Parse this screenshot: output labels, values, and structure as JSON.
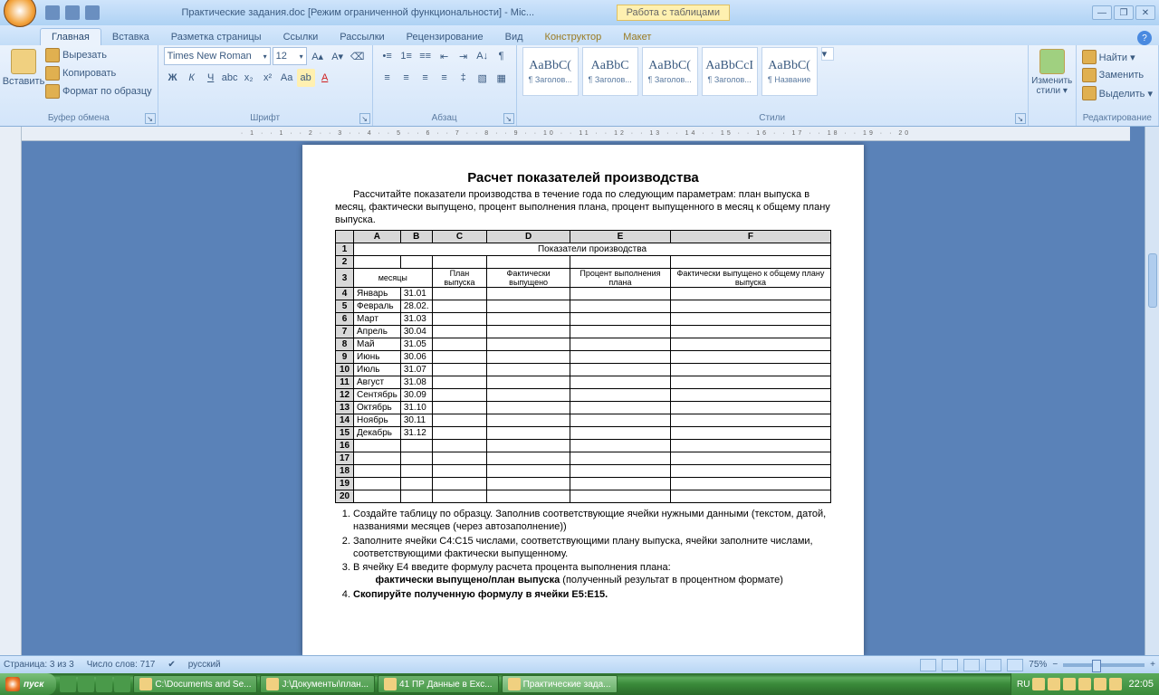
{
  "titlebar": {
    "doc_title": "Практические задания.doc [Режим ограниченной функциональности] - Mic...",
    "context_tool": "Работа с таблицами"
  },
  "tabs": {
    "t1": "Главная",
    "t2": "Вставка",
    "t3": "Разметка страницы",
    "t4": "Ссылки",
    "t5": "Рассылки",
    "t6": "Рецензирование",
    "t7": "Вид",
    "t8": "Конструктор",
    "t9": "Макет"
  },
  "clipboard": {
    "paste": "Вставить",
    "cut": "Вырезать",
    "copy": "Копировать",
    "format_painter": "Формат по образцу",
    "group": "Буфер обмена"
  },
  "font": {
    "name": "Times New Roman",
    "size": "12",
    "group": "Шрифт"
  },
  "para": {
    "group": "Абзац"
  },
  "styles": {
    "group": "Стили",
    "change": "Изменить стили ▾",
    "items": [
      {
        "prev": "AaBbC(",
        "name": "¶ Заголов..."
      },
      {
        "prev": "AaBbC",
        "name": "¶ Заголов..."
      },
      {
        "prev": "AaBbC(",
        "name": "¶ Заголов..."
      },
      {
        "prev": "AaBbCcI",
        "name": "¶ Заголов..."
      },
      {
        "prev": "AaBbC(",
        "name": "¶ Название"
      }
    ]
  },
  "editing": {
    "find": "Найти ▾",
    "replace": "Заменить",
    "select": "Выделить ▾",
    "group": "Редактирование"
  },
  "ruler": "· 1 ·  · 1 ·  · 2 ·  · 3 ·  · 4 ·  · 5 ·  · 6 ·  · 7 ·  · 8 ·  · 9 ·  · 10 ·  · 11 ·  · 12 ·  · 13 ·  · 14 ·  · 15 ·  · 16 ·  · 17 ·  · 18 ·  · 19 ·  · 20",
  "doc": {
    "title": "Расчет показателей производства",
    "intro": "Рассчитайте показатели производства в течение года по следующим параметрам: план выпуска в месяц,  фактически выпущено, процент выполнения плана, процент выпущенного в месяц к общему плану выпуска.",
    "cols": [
      "A",
      "B",
      "C",
      "D",
      "E",
      "F"
    ],
    "merged_title": "Показатели производства",
    "headers": [
      "месяцы",
      "",
      "План выпуска",
      "Фактически выпущено",
      "Процент выполнения плана",
      "Фактически выпущено к общему плану выпуска"
    ],
    "rows": [
      {
        "n": "4",
        "m": "Январь",
        "d": "31.01"
      },
      {
        "n": "5",
        "m": "Февраль",
        "d": "28.02."
      },
      {
        "n": "6",
        "m": "Март",
        "d": "31.03"
      },
      {
        "n": "7",
        "m": "Апрель",
        "d": "30.04"
      },
      {
        "n": "8",
        "m": "Май",
        "d": "31.05"
      },
      {
        "n": "9",
        "m": "Июнь",
        "d": "30.06"
      },
      {
        "n": "10",
        "m": "Июль",
        "d": "31.07"
      },
      {
        "n": "11",
        "m": "Август",
        "d": "31.08"
      },
      {
        "n": "12",
        "m": "Сентябрь",
        "d": "30.09"
      },
      {
        "n": "13",
        "m": "Октябрь",
        "d": "31.10"
      },
      {
        "n": "14",
        "m": "Ноябрь",
        "d": "30.11"
      },
      {
        "n": "15",
        "m": "Декабрь",
        "d": "31.12"
      },
      {
        "n": "16",
        "m": "",
        "d": ""
      },
      {
        "n": "17",
        "m": "",
        "d": ""
      },
      {
        "n": "18",
        "m": "",
        "d": ""
      },
      {
        "n": "19",
        "m": "",
        "d": ""
      },
      {
        "n": "20",
        "m": "",
        "d": ""
      }
    ],
    "tasks": [
      "Создайте таблицу по образцу. Заполнив соответствующие ячейки нужными данными (текстом,  датой, названиями месяцев (через автозаполнение))",
      "Заполните  ячейки C4:C15 числами, соответствующими плану выпуска, ячейки заполните числами, соответствующими фактически выпущенному.",
      "В ячейку E4 введите формулу расчета процента выполнения плана:",
      "Скопируйте полученную формулу в ячейки E5:E15."
    ],
    "task3_formula": "фактически выпущено/план выпуска",
    "task3_suffix": " (полученный результат в процентном формате)"
  },
  "status": {
    "page": "Страница: 3 из 3",
    "words": "Число слов: 717",
    "lang": "русский",
    "zoom": "75%"
  },
  "taskbar": {
    "start": "пуск",
    "t1": "C:\\Documents and Se...",
    "t2": "J:\\Документы\\план...",
    "t3": "41 ПР Данные в Exc...",
    "t4": "Практические зада...",
    "lang": "RU",
    "clock": "22:05"
  }
}
